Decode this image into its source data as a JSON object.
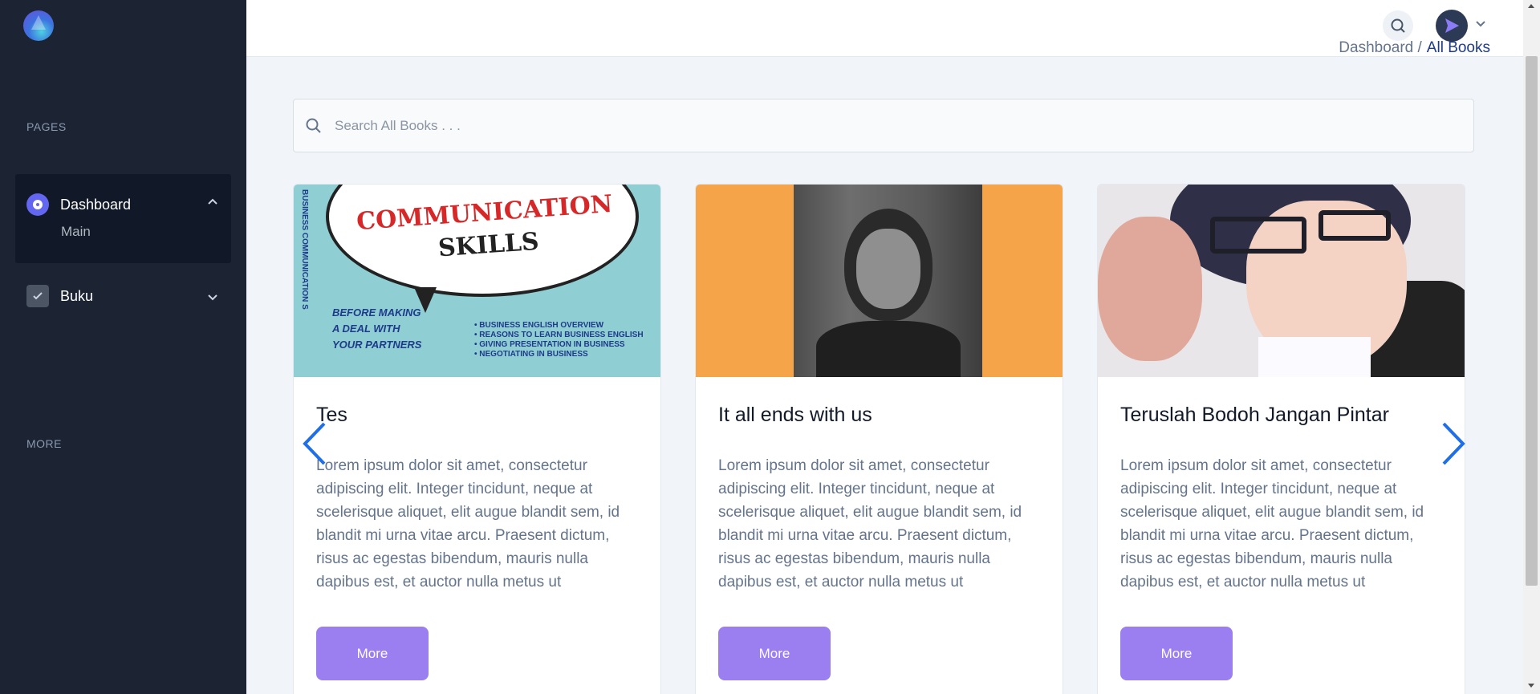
{
  "sidebar": {
    "section_pages": "PAGES",
    "section_more": "MORE",
    "items": [
      {
        "label": "Dashboard",
        "icon": "dashboard-icon",
        "expanded": true,
        "sub_items": [
          "Main"
        ]
      },
      {
        "label": "Buku",
        "icon": "calendar-check-icon",
        "expanded": false
      }
    ]
  },
  "header": {
    "breadcrumb": {
      "parent": "Dashboard /",
      "current": "All Books"
    }
  },
  "search": {
    "placeholder": "Search All Books . . ."
  },
  "cards": [
    {
      "title": "Tes",
      "description": "Lorem ipsum dolor sit amet, consectetur adipiscing elit. Integer tincidunt, neque at scelerisque aliquet, elit augue blandit sem, id blandit mi urna vitae arcu. Praesent dictum, risus ac egestas bibendum, mauris nulla dapibus est, et auctor nulla metus ut",
      "button": "More",
      "cover": {
        "line1": "COMMUNICATION",
        "line2": "SKILLS",
        "side_text": "BUSINESS COMMUNICATION S",
        "sub_lines": [
          "BEFORE MAKING",
          "A DEAL WITH",
          "YOUR PARTNERS"
        ],
        "bullets": [
          "• BUSINESS ENGLISH OVERVIEW",
          "• REASONS TO LEARN BUSINESS ENGLISH",
          "• GIVING PRESENTATION IN BUSINESS",
          "• NEGOTIATING IN BUSINESS"
        ]
      }
    },
    {
      "title": "It all ends with us",
      "description": "Lorem ipsum dolor sit amet, consectetur adipiscing elit. Integer tincidunt, neque at scelerisque aliquet, elit augue blandit sem, id blandit mi urna vitae arcu. Praesent dictum, risus ac egestas bibendum, mauris nulla dapibus est, et auctor nulla metus ut",
      "button": "More"
    },
    {
      "title": "Teruslah Bodoh Jangan Pintar",
      "description": "Lorem ipsum dolor sit amet, consectetur adipiscing elit. Integer tincidunt, neque at scelerisque aliquet, elit augue blandit sem, id blandit mi urna vitae arcu. Praesent dictum, risus ac egestas bibendum, mauris nulla dapibus est, et auctor nulla metus ut",
      "button": "More"
    }
  ],
  "colors": {
    "sidebar_bg": "#1c2434",
    "accent_button": "#9b7ef0",
    "carousel_arrow": "#1e6fe8"
  }
}
